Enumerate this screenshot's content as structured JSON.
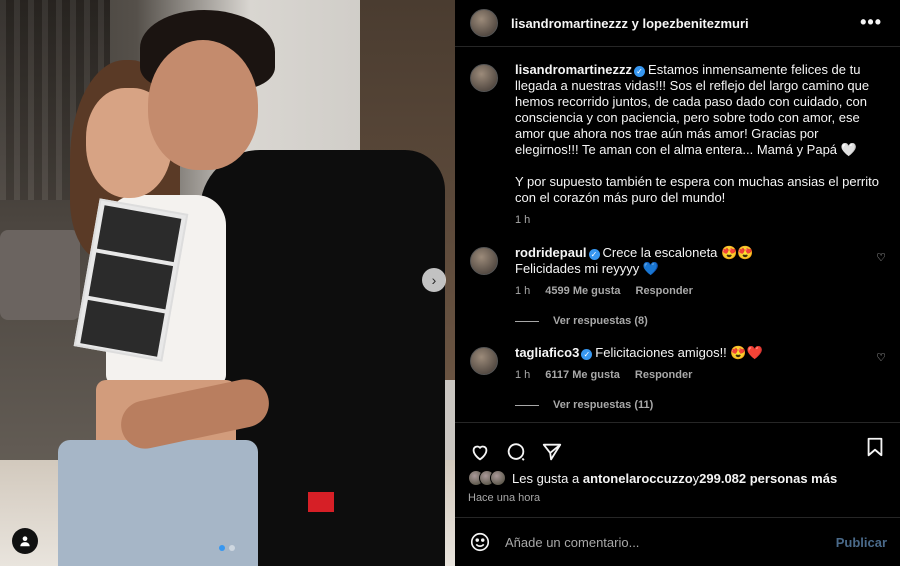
{
  "post": {
    "header_title": "lisandromartinezzz y lopezbenitezmuri",
    "more_icon": "more-horizontal-icon"
  },
  "caption": {
    "username": "lisandromartinezzz",
    "paragraph1": "Estamos inmensamente felices de tu llegada a nuestras vidas!!! Sos el reflejo del largo camino que hemos recorrido juntos, de cada paso dado con cuidado, con consciencia y con paciencia, pero sobre todo con amor, ese amor que ahora nos trae aún más amor! Gracias por elegirnos!!! Te aman con el alma entera... Mamá y Papá 🤍",
    "paragraph2": "Y por supuesto también te espera con muchas ansias el perrito con el corazón más puro del mundo!",
    "time": "1 h"
  },
  "comments": [
    {
      "username": "rodridepaul",
      "text_line1": "Crece la escaloneta 😍😍",
      "text_line2": "Felicidades mi reyyyy 💙",
      "time": "1 h",
      "likes": "4599 Me gusta",
      "reply": "Responder",
      "view_replies": "Ver respuestas (8)"
    },
    {
      "username": "tagliafico3",
      "text_line1": "Felicitaciones amigos!! 😍❤️",
      "time": "1 h",
      "likes": "6117 Me gusta",
      "reply": "Responder",
      "view_replies": "Ver respuestas (11)"
    }
  ],
  "likes": {
    "prefix": "Les gusta a ",
    "user": "antonelaroccuzzo",
    "connector": " y ",
    "others": "299.082 personas más"
  },
  "posted_ago": "Hace una hora",
  "comment_box": {
    "placeholder": "Añade un comentario...",
    "publish_label": "Publicar"
  },
  "carousel": {
    "next_label": "›",
    "slide_count": 2,
    "active_slide": 1
  },
  "colors": {
    "background": "#000000",
    "verified": "#3797f0",
    "secondary_text": "#a8a8a8",
    "publish_disabled": "#4a6a8a"
  }
}
